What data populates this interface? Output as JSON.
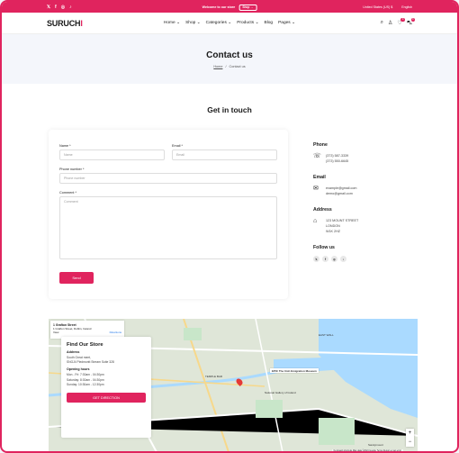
{
  "topbar": {
    "social": [
      "𝕏",
      "f",
      "◎",
      "♪"
    ],
    "promo_text": "Welcome to our store",
    "shop_now": "Shop →",
    "region": "United States (US) $",
    "language": "English"
  },
  "header": {
    "logo": "SURUCH",
    "logo_accent": "I",
    "nav": [
      "Home ⌄",
      "Shop ⌄",
      "Categories ⌄",
      "Products ⌄",
      "Blog",
      "Pages ⌄"
    ],
    "wishlist_count": "0",
    "cart_count": "0"
  },
  "hero": {
    "title": "Contact us",
    "crumb_home": "Home",
    "crumb_sep": "/",
    "crumb_current": "Contact us"
  },
  "section": {
    "title": "Get in touch"
  },
  "form": {
    "name_label": "Name *",
    "name_placeholder": "Name",
    "email_label": "Email *",
    "email_placeholder": "Email",
    "phone_label": "Phone number *",
    "phone_placeholder": "Phone number",
    "comment_label": "Comment *",
    "comment_placeholder": "Comment",
    "send_label": "Send"
  },
  "info": {
    "phone_title": "Phone",
    "phone_lines": [
      "(373) 587-3339",
      "(373) 550-6645"
    ],
    "email_title": "Email",
    "email_lines": [
      "example@gmail.com",
      "demo@gmail.com"
    ],
    "address_title": "Address",
    "address_lines": [
      "123 MOUNT STREET",
      "LONDON",
      "W1K 2HZ"
    ],
    "follow_title": "Follow us",
    "follow_icons": [
      "𝕏",
      "f",
      "◎",
      "♪"
    ]
  },
  "map": {
    "place_title": "1 Grafton Street",
    "place_addr": "1 Grafton Street, Dublin, Ireland",
    "place_view": "View",
    "directions": "Directions",
    "store_title": "Find Our Store",
    "address_heading": "Address",
    "address_lines": [
      "South Great meet,",
      "SNGJ4 Piedmontt Stream Suite 328"
    ],
    "hours_heading": "Opening hours",
    "hours_lines": [
      "Mon - Fri: 7:30am - 04:30pm",
      "Saturday: 8:30am - 04:30pm",
      "Sunday: 10:30am - 12:30pm"
    ],
    "direction_btn": "GET DIRECTION",
    "labels": {
      "east_wall": "EAST WALL",
      "museum": "EPIC The Irish Emigration Museum",
      "gallery": "National Gallery of Ireland",
      "temple": "TEMPLE BAR",
      "sandymount": "Sandymount"
    },
    "attribution": "Keyboard shortcuts  Map data ©2024 Google  Terms  Report a map error",
    "zoom_in": "+",
    "zoom_out": "−"
  }
}
